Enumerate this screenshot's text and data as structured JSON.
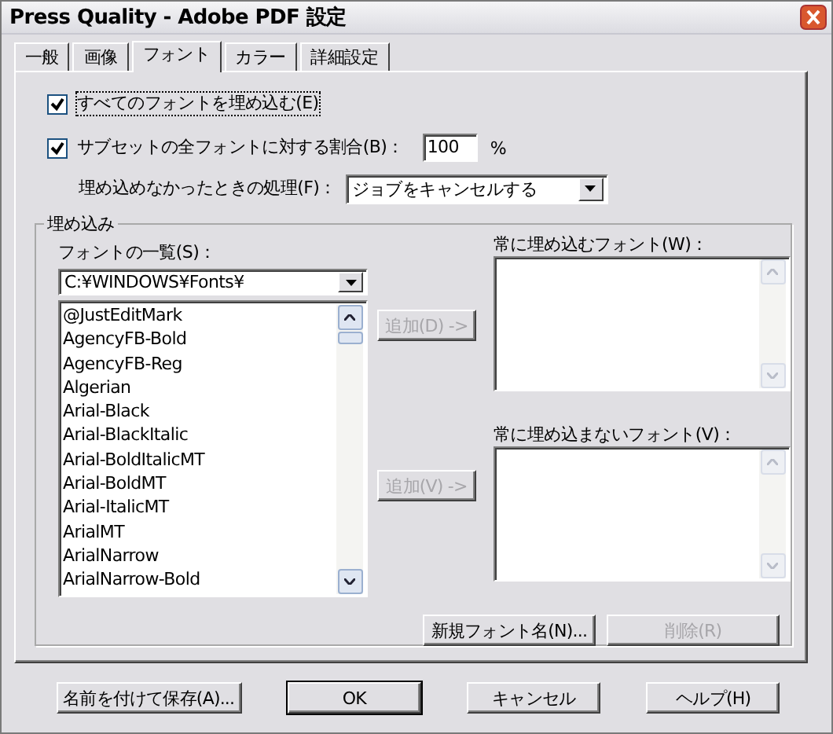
{
  "window": {
    "title": "Press Quality - Adobe PDF 設定"
  },
  "tabs": [
    {
      "label": "一般",
      "selected": false
    },
    {
      "label": "画像",
      "selected": false
    },
    {
      "label": "フォント",
      "selected": true
    },
    {
      "label": "カラー",
      "selected": false
    },
    {
      "label": "詳細設定",
      "selected": false
    }
  ],
  "embed_all": {
    "label": "すべてのフォントを埋め込む(E)",
    "checked": true
  },
  "subset": {
    "label": "サブセットの全フォントに対する割合(B)：",
    "checked": true,
    "value": "100",
    "unit": "%"
  },
  "failure": {
    "label": "埋め込めなかったときの処理(F)：",
    "value": "ジョブをキャンセルする"
  },
  "embedding": {
    "title": "埋め込み",
    "font_list_label": "フォントの一覧(S)：",
    "font_folder": "C:¥WINDOWS¥Fonts¥",
    "fonts": [
      "@JustEditMark",
      "AgencyFB-Bold",
      "AgencyFB-Reg",
      "Algerian",
      "Arial-Black",
      "Arial-BlackItalic",
      "Arial-BoldItalicMT",
      "Arial-BoldMT",
      "Arial-ItalicMT",
      "ArialMT",
      "ArialNarrow",
      "ArialNarrow-Bold"
    ],
    "always_add_button": {
      "label": "追加(D) ->",
      "disabled": true
    },
    "always_label": "常に埋め込むフォント(W)：",
    "never_add_button": {
      "label": "追加(V) ->",
      "disabled": true
    },
    "never_label": "常に埋め込まないフォント(V)：",
    "new_font_button": {
      "label": "新規フォント名(N)...",
      "disabled": false
    },
    "remove_button": {
      "label": "削除(R)",
      "disabled": true
    }
  },
  "buttons": [
    {
      "label": "名前を付けて保存(A)...",
      "default": false
    },
    {
      "label": "OK",
      "default": true
    },
    {
      "label": "キャンセル",
      "default": false
    },
    {
      "label": "ヘルプ(H)",
      "default": false
    }
  ]
}
